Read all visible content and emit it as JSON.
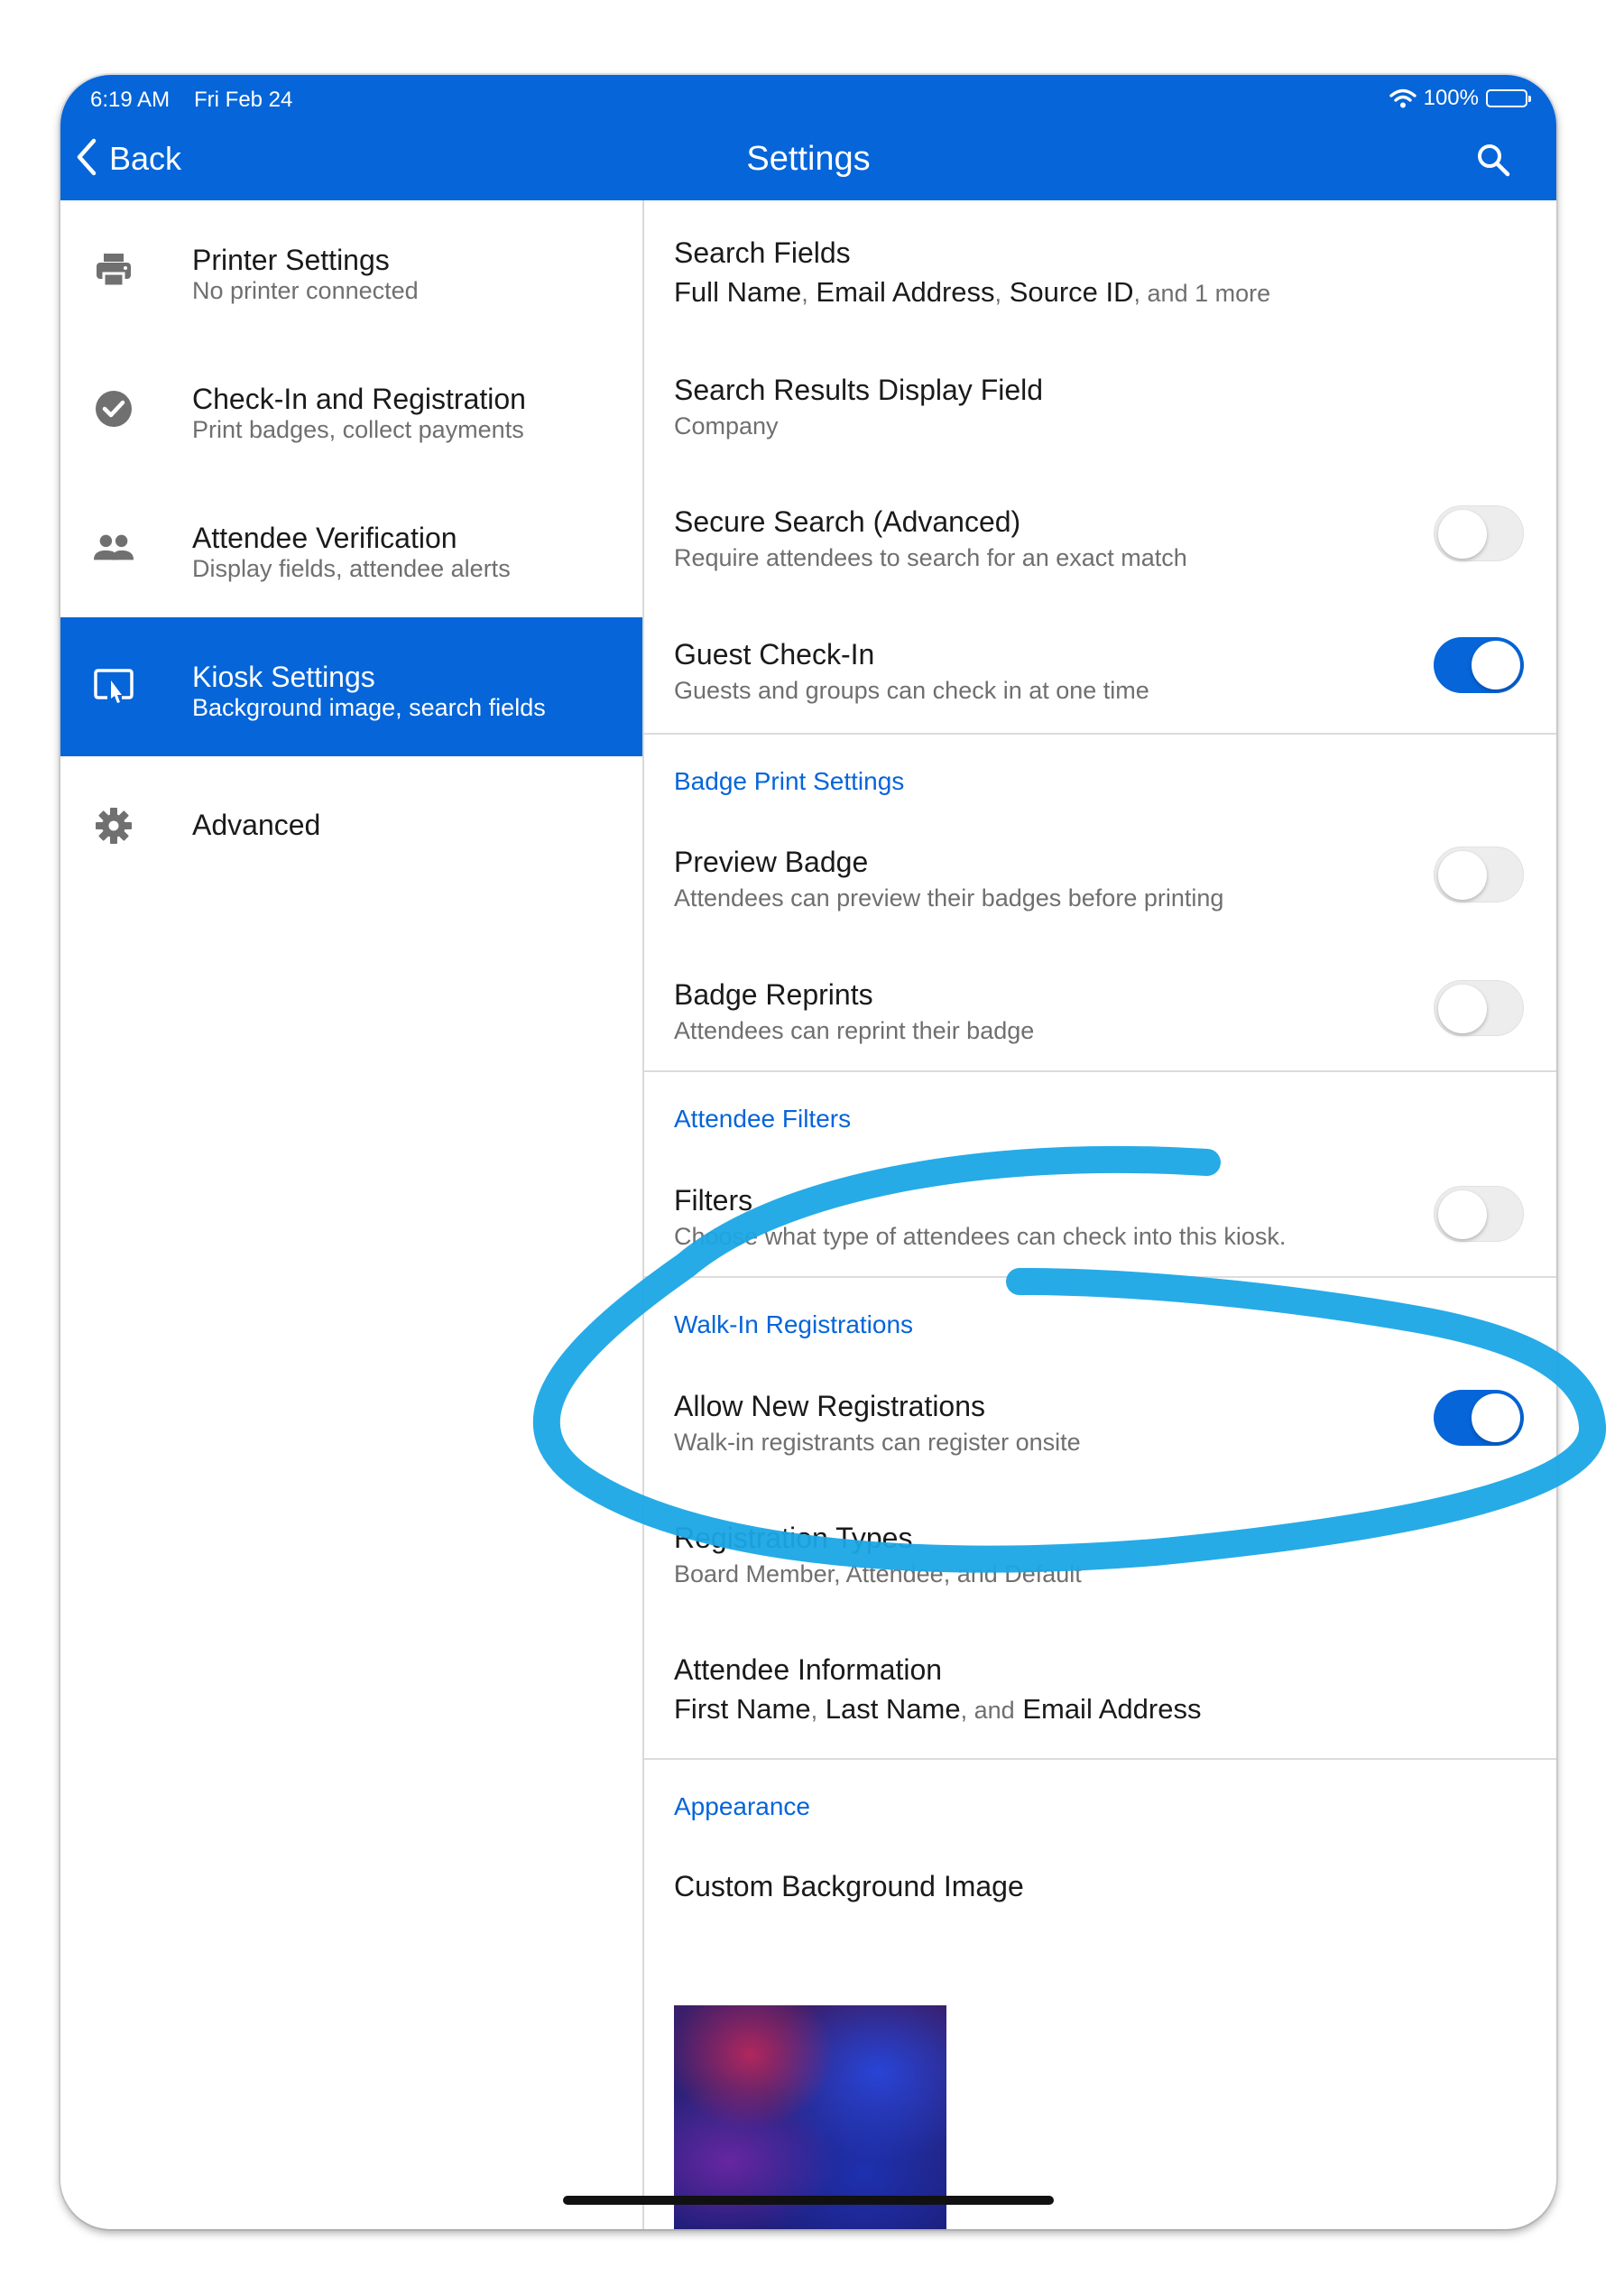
{
  "status_bar": {
    "time": "6:19 AM",
    "date": "Fri Feb 24",
    "battery": "100%"
  },
  "nav": {
    "back_label": "Back",
    "title": "Settings"
  },
  "sidebar": {
    "items": [
      {
        "title": "Printer Settings",
        "subtitle": "No printer connected"
      },
      {
        "title": "Check-In and Registration",
        "subtitle": "Print badges, collect payments"
      },
      {
        "title": "Attendee Verification",
        "subtitle": "Display fields, attendee alerts"
      },
      {
        "title": "Kiosk Settings",
        "subtitle": "Background image, search fields",
        "active": true
      },
      {
        "title": "Advanced",
        "subtitle": ""
      }
    ]
  },
  "main": {
    "search_fields": {
      "title": "Search Fields",
      "value_1": "Full Name",
      "sep_1": ",",
      "value_2": "Email Address",
      "sep_2": ",",
      "value_3": "Source ID",
      "more": ", and 1 more"
    },
    "search_results_display": {
      "title": "Search Results Display Field",
      "value": "Company"
    },
    "secure_search": {
      "title": "Secure Search (Advanced)",
      "subtitle": "Require attendees to search for an exact match",
      "enabled": false
    },
    "guest_checkin": {
      "title": "Guest Check-In",
      "subtitle": "Guests and groups can check in at one time",
      "enabled": true
    },
    "badge_section": "Badge Print Settings",
    "preview_badge": {
      "title": "Preview Badge",
      "subtitle": "Attendees can preview their badges before printing",
      "enabled": false
    },
    "badge_reprints": {
      "title": "Badge Reprints",
      "subtitle": "Attendees can reprint their badge",
      "enabled": false
    },
    "filters_section": "Attendee Filters",
    "filters": {
      "title": "Filters",
      "subtitle": "Choose what type of attendees can check into this kiosk.",
      "enabled": false
    },
    "walkin_section": "Walk-In Registrations",
    "allow_new": {
      "title": "Allow New Registrations",
      "subtitle": "Walk-in registrants can register onsite",
      "enabled": true
    },
    "registration_types": {
      "title": "Registration Types",
      "subtitle": "Board Member, Attendee, and Default"
    },
    "attendee_information": {
      "title": "Attendee Information",
      "value_1": "First Name",
      "sep_1": ",",
      "value_2": "Last Name",
      "sep_2": ", and",
      "value_3": "Email Address"
    },
    "appearance_section": "Appearance",
    "custom_background": {
      "title": "Custom Background Image"
    }
  },
  "colors": {
    "brand_blue": "#0565d9",
    "annotation_cyan": "#1aa6e6"
  }
}
